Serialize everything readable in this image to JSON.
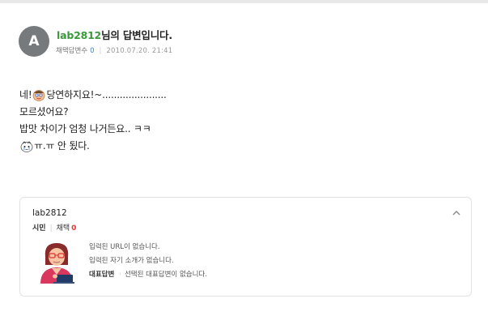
{
  "answer": {
    "avatar_letter": "A",
    "username": "lab2812",
    "title_suffix": "님의 답변입니다.",
    "meta": {
      "adopted_label": "채택답변수",
      "adopted_count": "0",
      "date": "2010.07.20. 21:41"
    },
    "body": {
      "line1_pre": "네!",
      "line1_post": "당연하지요!~......................",
      "line2": "모르셨어요?",
      "line3": "밥맛 차이가 엄청 나거든요.. ㅋㅋ",
      "line4": "ㅠ.ㅠ 안 됬다."
    },
    "emoticons": [
      "smiling-face-icon",
      "crying-face-icon"
    ]
  },
  "profile_card": {
    "username": "lab2812",
    "rank_label": "시민",
    "adopt_label": "채택",
    "adopt_count": "0",
    "lines": [
      "입력된 URL이 없습니다.",
      "입력된 자기 소개가 없습니다."
    ],
    "rep_answer_label": "대표답변",
    "rep_answer_text": "선택된 대표답변이 없습니다."
  },
  "colors": {
    "username_green": "#3a9a3a",
    "count_blue": "#3a86c8",
    "count_red": "#e03a3a",
    "avatar_gray": "#777a7d"
  }
}
